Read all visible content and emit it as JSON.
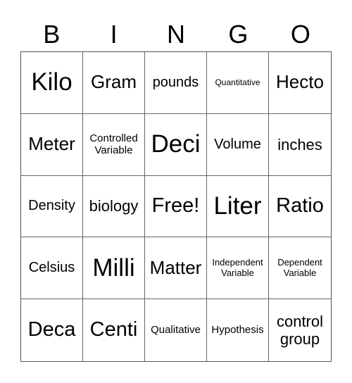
{
  "header": [
    "B",
    "I",
    "N",
    "G",
    "O"
  ],
  "cells": [
    "Kilo",
    "Gram",
    "pounds",
    "Quantitative",
    "Hecto",
    "Meter",
    "Controlled Variable",
    "Deci",
    "Volume",
    "inches",
    "Density",
    "biology",
    "Free!",
    "Liter",
    "Ratio",
    "Celsius",
    "Milli",
    "Matter",
    "Independent Variable",
    "Dependent Variable",
    "Deca",
    "Centi",
    "Qualitative",
    "Hypothesis",
    "control group"
  ]
}
